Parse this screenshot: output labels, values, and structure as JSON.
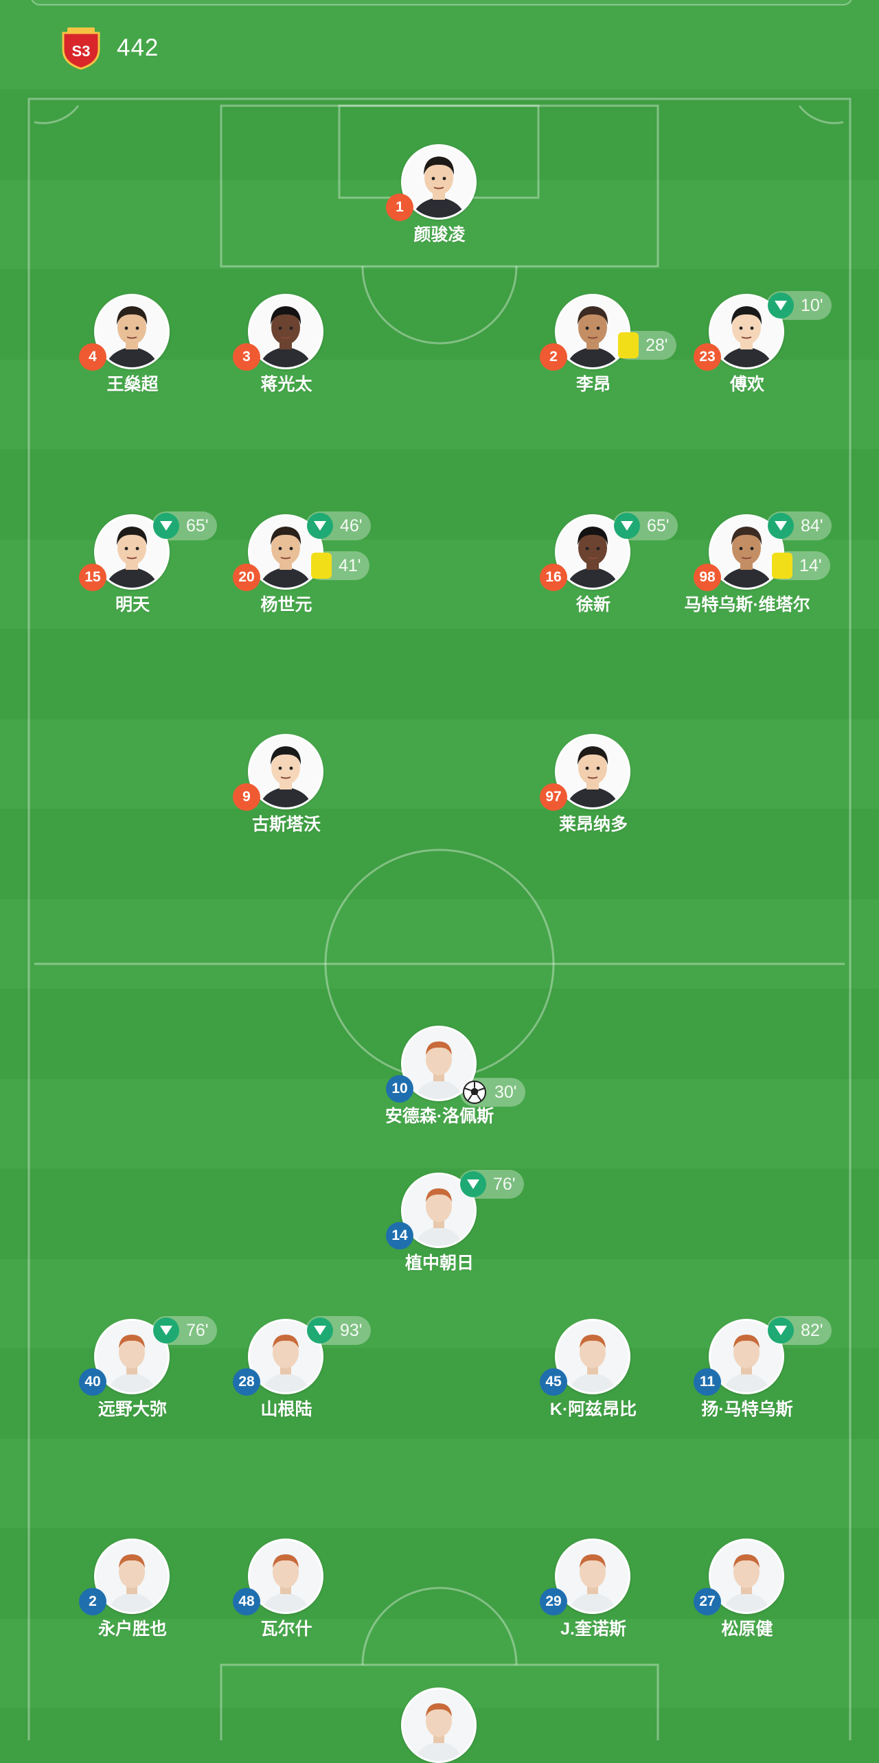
{
  "team": {
    "formation": "442",
    "crest_icon": "club-crest-icon"
  },
  "colors": {
    "home_number": "#f05a32",
    "away_number": "#1f6faf",
    "sub_icon": "#1faa73",
    "yellow_card": "#f2de18"
  },
  "home_players": [
    {
      "number": "1",
      "name": "颜骏凌"
    },
    {
      "number": "4",
      "name": "王燊超"
    },
    {
      "number": "3",
      "name": "蒋光太"
    },
    {
      "number": "2",
      "name": "李昂",
      "card_minute": "28'"
    },
    {
      "number": "23",
      "name": "傅欢",
      "sub_minute": "10'"
    },
    {
      "number": "15",
      "name": "明天",
      "sub_minute": "65'"
    },
    {
      "number": "20",
      "name": "杨世元",
      "sub_minute": "46'",
      "card_minute": "41'"
    },
    {
      "number": "16",
      "name": "徐新",
      "sub_minute": "65'"
    },
    {
      "number": "98",
      "name": "马特乌斯·维塔尔",
      "sub_minute": "84'",
      "card_minute": "14'"
    },
    {
      "number": "9",
      "name": "古斯塔沃"
    },
    {
      "number": "97",
      "name": "莱昂纳多"
    }
  ],
  "away_players": [
    {
      "number": "10",
      "name": "安德森·洛佩斯",
      "goal_minute": "30'"
    },
    {
      "number": "14",
      "name": "植中朝日",
      "sub_minute": "76'"
    },
    {
      "number": "40",
      "name": "远野大弥",
      "sub_minute": "76'"
    },
    {
      "number": "28",
      "name": "山根陆",
      "sub_minute": "93'"
    },
    {
      "number": "45",
      "name": "K·阿兹昂比"
    },
    {
      "number": "11",
      "name": "扬·马特乌斯",
      "sub_minute": "82'"
    },
    {
      "number": "2",
      "name": "永户胜也"
    },
    {
      "number": "48",
      "name": "瓦尔什"
    },
    {
      "number": "29",
      "name": "J.奎诺斯"
    },
    {
      "number": "27",
      "name": "松原健"
    },
    {
      "number": "",
      "name": ""
    }
  ]
}
